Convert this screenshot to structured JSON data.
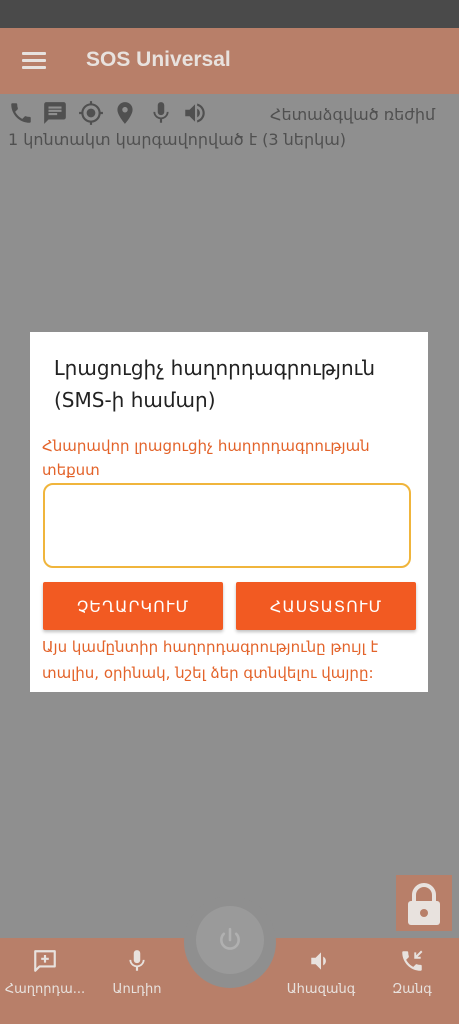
{
  "app": {
    "title": "SOS Universal"
  },
  "toolbar": {
    "icons": [
      "phone-icon",
      "sms-icon",
      "gps-icon",
      "location-pin-icon",
      "microphone-icon",
      "volume-icon"
    ],
    "mode_text": "Հետաձգված ռեժիմ",
    "contact_status": "1 կոնտակտ կարգավորված է (3 ներկա)"
  },
  "dialog": {
    "title": "Լրացուցիչ հաղորդագրություն (SMS-ի համար)",
    "field_label": "Հնարավոր լրացուցիչ հաղորդագրության տեքստ",
    "input_value": "",
    "cancel_label": "ՉԵՂԱՐԿՈՒՄ",
    "confirm_label": "ՀԱՍՏԱՏՈՒՄ",
    "hint": "Այս կամընտիր հաղորդագրությունը թույլ է տալիս, օրինակ, նշել ձեր գտնվելու վայրը:"
  },
  "bottom_nav": {
    "items": [
      {
        "label": "Հաղորդա...",
        "icon": "add-message-icon"
      },
      {
        "label": "Աուդիո",
        "icon": "microphone-icon"
      },
      {
        "label": "Ահազանգ",
        "icon": "volume-icon"
      },
      {
        "label": "Զանգ",
        "icon": "call-received-icon"
      }
    ]
  },
  "colors": {
    "app_bar": "#b87f69",
    "accent": "#f25a22",
    "label": "#e3632a",
    "input_border": "#f0b53c",
    "overlay": "#8f8f8f"
  }
}
